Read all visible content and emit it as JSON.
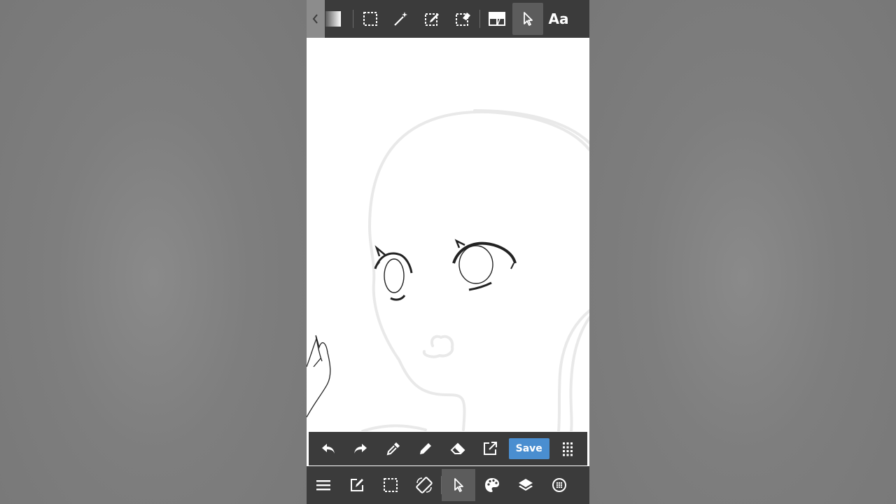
{
  "app": {
    "accent_color": "#4a8ed0",
    "toolbar_color": "#3b3b3b"
  },
  "top_toolbar": {
    "items": [
      {
        "icon": "chevron-left-icon"
      },
      {
        "icon": "gradient-swatch"
      },
      {
        "icon": "select-rectangle-icon"
      },
      {
        "icon": "magic-wand-icon"
      },
      {
        "icon": "select-pen-icon"
      },
      {
        "icon": "select-eraser-icon"
      },
      {
        "icon": "frame-divider-icon"
      },
      {
        "icon": "pointer-icon",
        "active": true
      },
      {
        "icon": "text-tool"
      }
    ],
    "text_tool_label": "Aa"
  },
  "action_bar": {
    "items": [
      "undo-icon",
      "redo-icon",
      "eyedropper-icon",
      "pen-icon",
      "eraser-icon",
      "export-icon",
      "save-button",
      "grid-menu-icon"
    ],
    "save_label": "Save"
  },
  "bottom_bar": {
    "items": [
      "menu-icon",
      "edit-icon",
      "selection-icon",
      "rotate-screen-icon",
      "pointer-icon",
      "palette-icon",
      "layers-icon",
      "material-icon"
    ],
    "active": "pointer-icon"
  }
}
